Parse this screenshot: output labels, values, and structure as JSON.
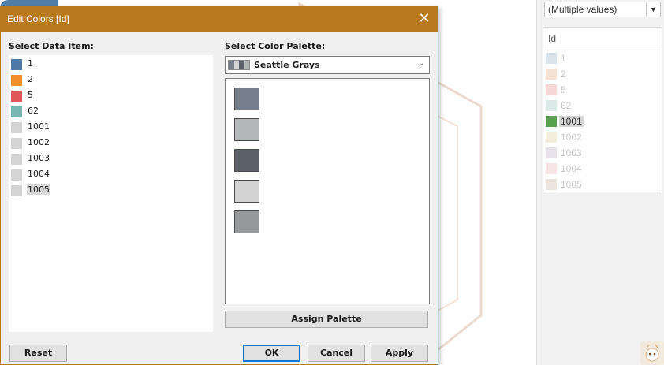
{
  "background": {
    "filter_dropdown": {
      "value": "(Multiple values)"
    },
    "legend": {
      "title": "Id",
      "items": [
        {
          "label": "1",
          "color": "#dbe3ea"
        },
        {
          "label": "2",
          "color": "#f5e2d2"
        },
        {
          "label": "5",
          "color": "#f4d7d6"
        },
        {
          "label": "62",
          "color": "#dbe9e7"
        },
        {
          "label": "1001",
          "color": "#59a14f",
          "active": true
        },
        {
          "label": "1002",
          "color": "#f2eedb"
        },
        {
          "label": "1003",
          "color": "#e7e1ea"
        },
        {
          "label": "1004",
          "color": "#f7e4e6"
        },
        {
          "label": "1005",
          "color": "#ebe4df"
        }
      ]
    }
  },
  "dialog": {
    "title": "Edit Colors [Id]",
    "close_glyph": "✕",
    "data_item_label": "Select Data Item:",
    "palette_label": "Select Color Palette:",
    "data_items": [
      {
        "label": "1",
        "color": "#4e79a7"
      },
      {
        "label": "2",
        "color": "#f28e2b"
      },
      {
        "label": "5",
        "color": "#e15759"
      },
      {
        "label": "62",
        "color": "#76b7b2"
      },
      {
        "label": "1001",
        "color": "#d4d4d4"
      },
      {
        "label": "1002",
        "color": "#d4d4d4"
      },
      {
        "label": "1003",
        "color": "#d4d4d4"
      },
      {
        "label": "1004",
        "color": "#d4d4d4"
      },
      {
        "label": "1005",
        "color": "#d4d4d4",
        "selected": true
      }
    ],
    "palette": {
      "name": "Seattle Grays",
      "arrow_glyph": "⌄",
      "swatches": [
        "#767f8b",
        "#b3b7b8",
        "#5c6068",
        "#d3d3d3",
        "#98999b"
      ]
    },
    "buttons": {
      "assign": "Assign Palette",
      "reset": "Reset",
      "ok": "OK",
      "cancel": "Cancel",
      "apply": "Apply"
    }
  }
}
